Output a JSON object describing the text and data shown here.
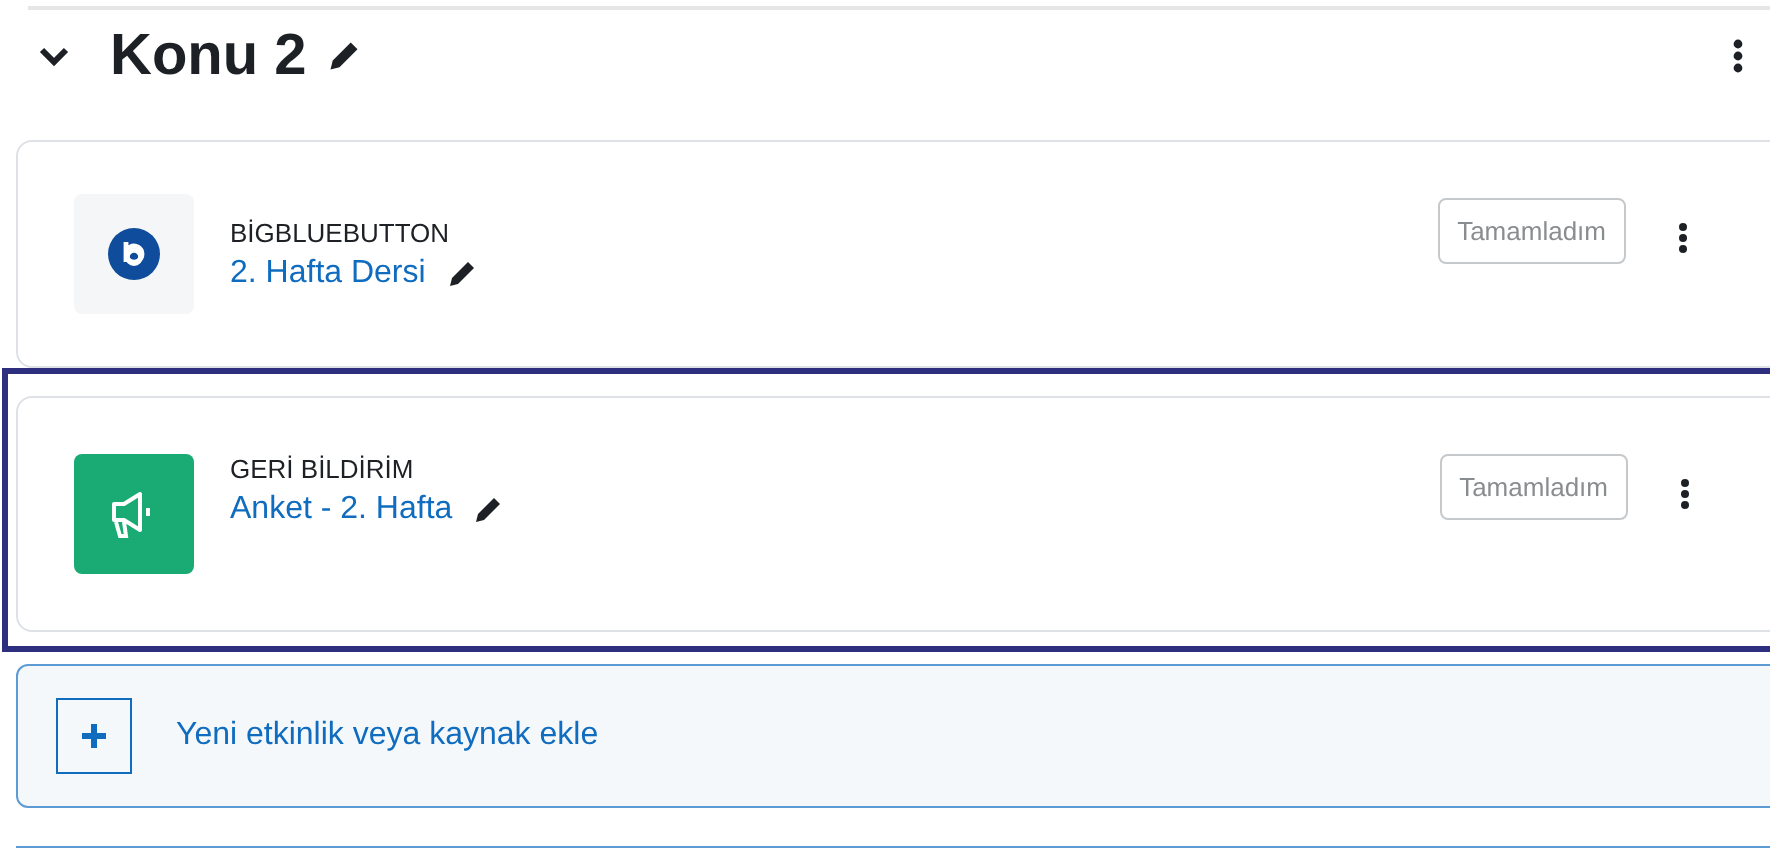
{
  "section": {
    "title": "Konu 2",
    "expanded": true
  },
  "activities": [
    {
      "kind": "bigbluebutton",
      "type_label": "BİGBLUEBUTTON",
      "name": "2. Hafta Dersi",
      "completion": "Tamamladım",
      "highlighted": false
    },
    {
      "kind": "feedback",
      "type_label": "GERİ BİLDİRİM",
      "name": "Anket - 2. Hafta",
      "completion": "Tamamladım",
      "highlighted": true
    }
  ],
  "add_activity": {
    "label": "Yeni etkinlik veya kaynak ekle"
  }
}
